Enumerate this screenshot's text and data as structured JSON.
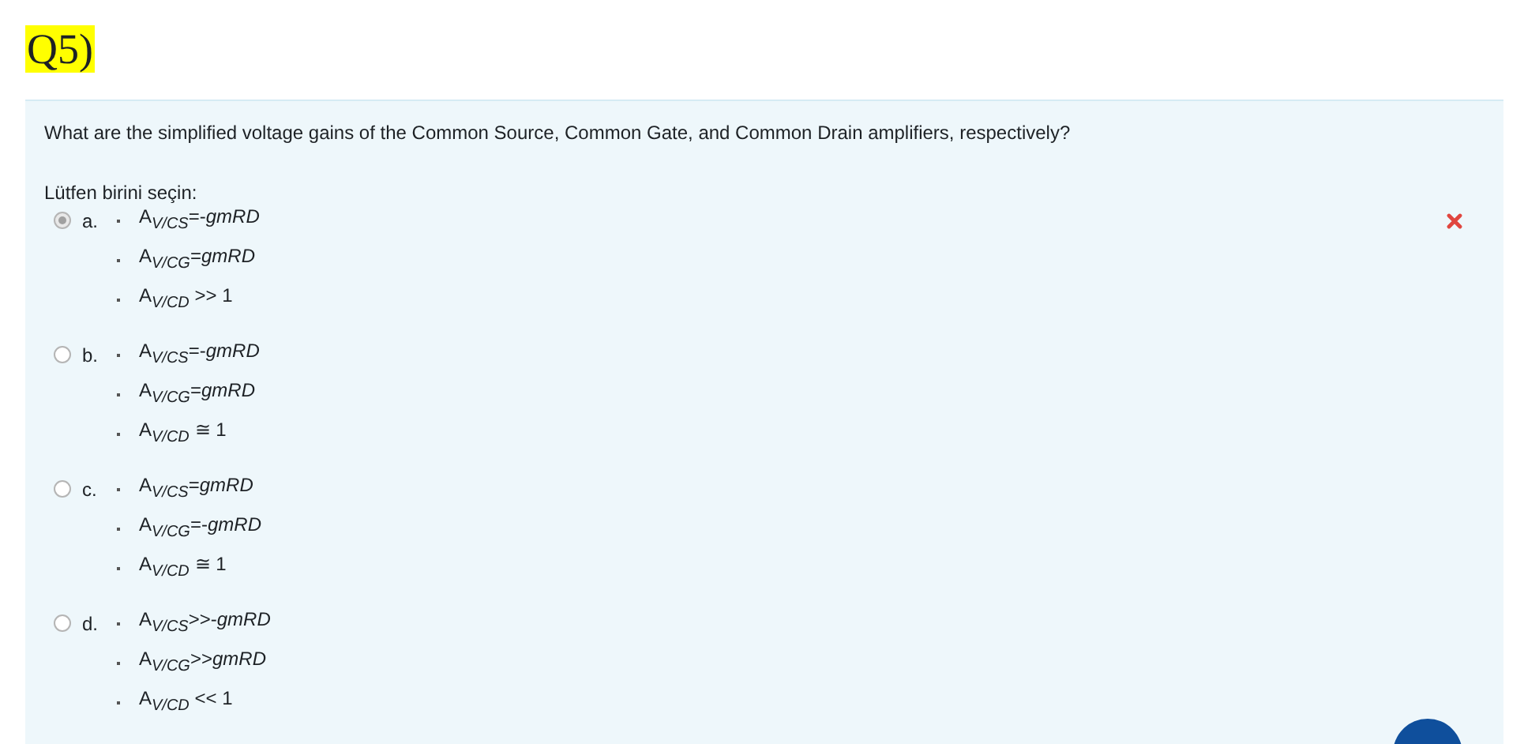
{
  "title": "Q5)",
  "question": "What are the simplified voltage gains of the Common Source, Common Gate, and Common Drain amplifiers, respectively?",
  "prompt": "Lütfen birini seçin:",
  "options": [
    {
      "letter": "a.",
      "selected": true,
      "incorrect": true,
      "lines": [
        "A$_{V/CS}$=-*gmRD*",
        "A$_{V/CG}$=*gmRD*",
        "A$_{V/CD}$ >> 1"
      ]
    },
    {
      "letter": "b.",
      "selected": false,
      "incorrect": false,
      "lines": [
        "A$_{V/CS}$=-*gmRD*",
        "A$_{V/CG}$=*gmRD*",
        "A$_{V/CD}$ ≅ 1"
      ]
    },
    {
      "letter": "c.",
      "selected": false,
      "incorrect": false,
      "lines": [
        "A$_{V/CS}$=*gmRD*",
        "A$_{V/CG}$=-*gmRD*",
        "A$_{V/CD}$ ≅ 1"
      ]
    },
    {
      "letter": "d.",
      "selected": false,
      "incorrect": false,
      "lines": [
        "A$_{V/CS}$>>-*gmRD*",
        "A$_{V/CG}$>>*gmRD*",
        "A$_{V/CD}$ << 1"
      ]
    }
  ]
}
